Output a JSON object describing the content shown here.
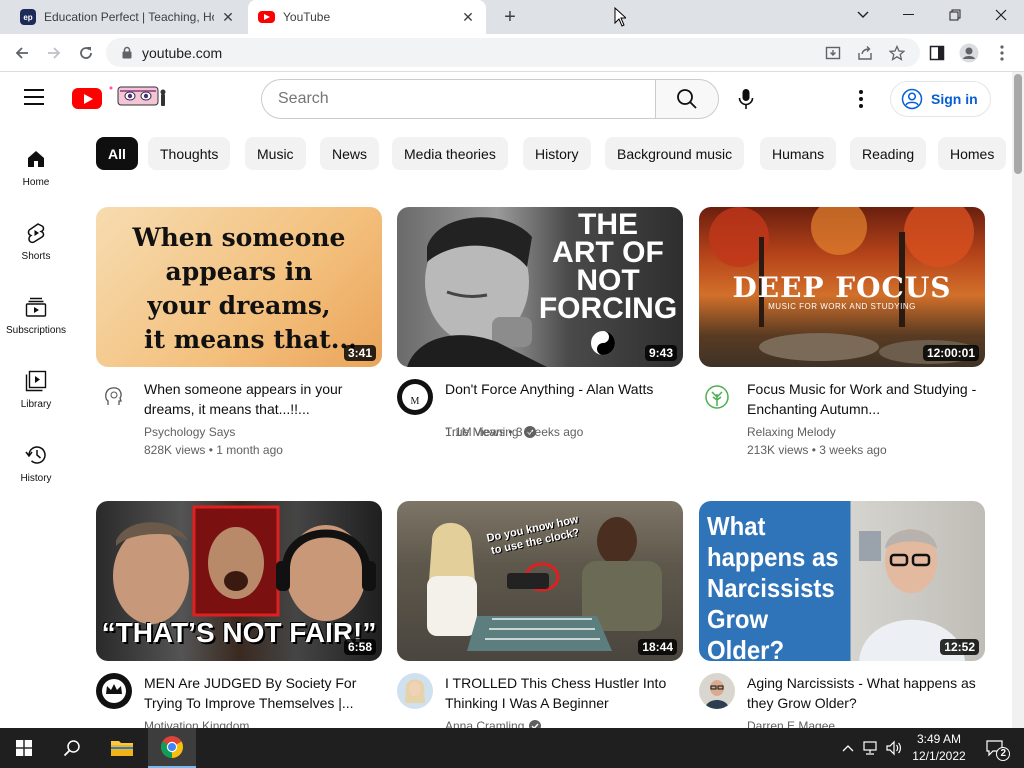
{
  "browser": {
    "tabs": [
      {
        "title": "Education Perfect | Teaching, Hom",
        "favicon": "ep-icon"
      },
      {
        "title": "YouTube",
        "favicon": "youtube-icon",
        "active": true
      }
    ],
    "url": "youtube.com"
  },
  "header": {
    "search_placeholder": "Search",
    "signin_label": "Sign in"
  },
  "chips": [
    "All",
    "Thoughts",
    "Music",
    "News",
    "Media theories",
    "History",
    "Background music",
    "Humans",
    "Reading",
    "Homes"
  ],
  "rail": [
    {
      "label": "Home",
      "icon": "home-icon"
    },
    {
      "label": "Shorts",
      "icon": "shorts-icon"
    },
    {
      "label": "Subscriptions",
      "icon": "subscriptions-icon"
    },
    {
      "label": "Library",
      "icon": "library-icon"
    },
    {
      "label": "History",
      "icon": "history-icon"
    }
  ],
  "videos": [
    {
      "title": "When someone appears in your dreams, it means that...!!...",
      "channel": "Psychology Says",
      "stats": "828K views • 1 month ago",
      "duration": "3:41",
      "thumb_text": [
        "When someone",
        "appears in",
        "your dreams,",
        "it means that..."
      ]
    },
    {
      "title": "Don't Force Anything - Alan Watts",
      "channel": "True Meaning",
      "verified": true,
      "stats": "1.1M views • 3 weeks ago",
      "duration": "9:43",
      "thumb_text": [
        "THE",
        "ART OF",
        "NOT",
        "FORCING"
      ]
    },
    {
      "title": "Focus Music for Work and Studying - Enchanting Autumn...",
      "channel": "Relaxing Melody",
      "stats": "213K views • 3 weeks ago",
      "duration": "12:00:01",
      "thumb_text": [
        "DEEP FOCUS",
        "MUSIC FOR WORK AND STUDYING"
      ]
    },
    {
      "title": "MEN Are JUDGED By Society For Trying To Improve Themselves |...",
      "channel": "Motivation Kingdom",
      "stats": "",
      "duration": "6:58",
      "thumb_text": [
        "“THAT’S NOT FAIR!”"
      ]
    },
    {
      "title": "I TROLLED This Chess Hustler Into Thinking I Was A Beginner",
      "channel": "Anna Cramling",
      "verified": true,
      "stats": "",
      "duration": "18:44",
      "thumb_text": [
        "Do you know how",
        "to use the clock?"
      ]
    },
    {
      "title": "Aging Narcissists - What happens as they Grow Older?",
      "channel": "Darren E Magee",
      "stats": "",
      "duration": "12:52",
      "thumb_text": [
        "What",
        "happens as",
        "Narcissists",
        "Grow Older?"
      ]
    }
  ],
  "taskbar": {
    "time": "3:49 AM",
    "date": "12/1/2022",
    "notification_count": "2"
  }
}
